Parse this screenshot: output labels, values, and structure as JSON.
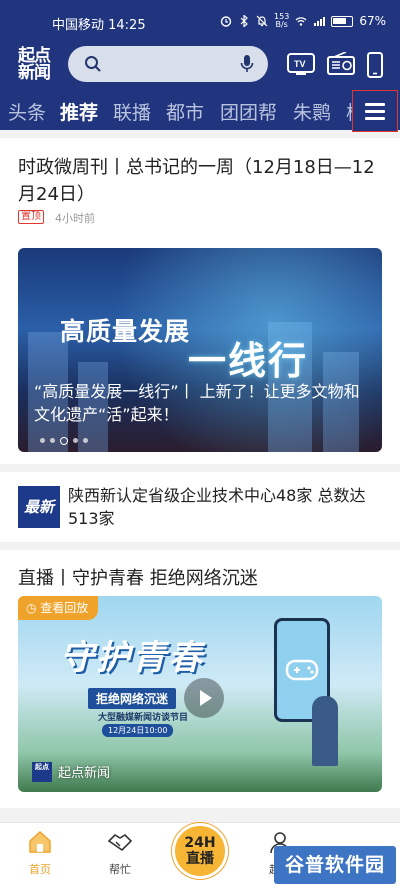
{
  "status_bar": {
    "carrier_time": "中国移动 14:25",
    "net_speed_value": "153",
    "net_speed_unit": "B/s",
    "battery": "67%"
  },
  "header": {
    "logo_line1": "起点",
    "logo_line2": "新闻",
    "search_placeholder": ""
  },
  "tabs": [
    "头条",
    "推荐",
    "联播",
    "都市",
    "团团帮",
    "朱鹮",
    "校"
  ],
  "active_tab": "推荐",
  "feed": {
    "top_article": {
      "title": "时政微周刊丨总书记的一周（12月18日—12月24日）",
      "badge": "置顶",
      "time": "4小时前"
    },
    "banner": {
      "headline": "高质量发展",
      "headline_brush": "一线行",
      "caption": "“高质量发展一线行”丨 上新了！让更多文物和文化遗产“活”起来！",
      "dot_count": 5,
      "active_dot": 2
    },
    "news_item": {
      "badge": "最新",
      "title": "陕西新认定省级企业技术中心48家  总数达513家"
    },
    "live_item": {
      "title": "直播丨守护青春  拒绝网络沉迷",
      "replay_label": "查看回放",
      "poster_title": "守护青春",
      "poster_strip": "拒绝网络沉迷",
      "poster_subtitle": "大型融媒新闻访谈节目",
      "poster_date": "12月24日10:00",
      "brand_logo": "起点",
      "brand_name": "起点新闻"
    }
  },
  "bottom_nav": {
    "items": [
      {
        "label": "首页",
        "icon": "home-icon"
      },
      {
        "label": "帮忙",
        "icon": "handshake-icon"
      },
      {
        "label": "起点",
        "icon": "profile-icon"
      }
    ],
    "live_line1": "24H",
    "live_line2": "直播"
  },
  "watermark": "谷普软件园",
  "colors": {
    "header_bg": "#20357e",
    "accent_orange": "#f0a32a",
    "badge_red": "#e0362f"
  }
}
